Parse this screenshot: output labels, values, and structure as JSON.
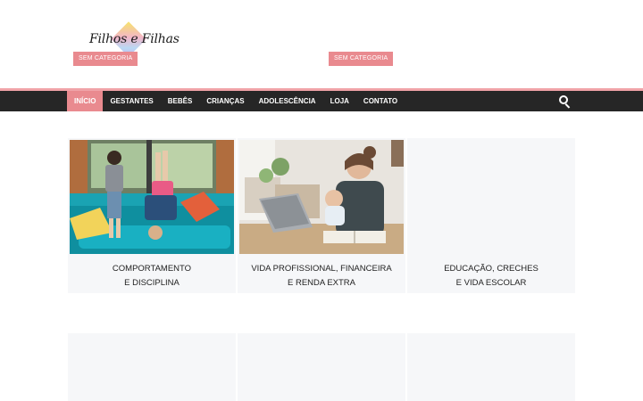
{
  "header": {
    "logo_text": "Filhos e Filhas",
    "tags": [
      "SEM CATEGORIA",
      "SEM CATEGORIA"
    ]
  },
  "nav": {
    "items": [
      "INÍCIO",
      "GESTANTES",
      "BEBÊS",
      "CRIANÇAS",
      "ADOLESCÊNCIA",
      "LOJA",
      "CONTATO"
    ],
    "active_index": 0,
    "search_icon": "search-icon"
  },
  "cards": [
    {
      "title_line1": "COMPORTAMENTO",
      "title_line2": "E DISCIPLINA"
    },
    {
      "title_line1": "VIDA PROFISSIONAL, FINANCEIRA",
      "title_line2": "E RENDA EXTRA"
    },
    {
      "title_line1": "EDUCAÇÃO, CRECHES",
      "title_line2": "E VIDA ESCOLAR"
    }
  ],
  "colors": {
    "accent": "#e98a8f",
    "nav_bg": "#262626",
    "nav_border": "#f0a3a8",
    "card_bg": "#f6f7f9"
  }
}
